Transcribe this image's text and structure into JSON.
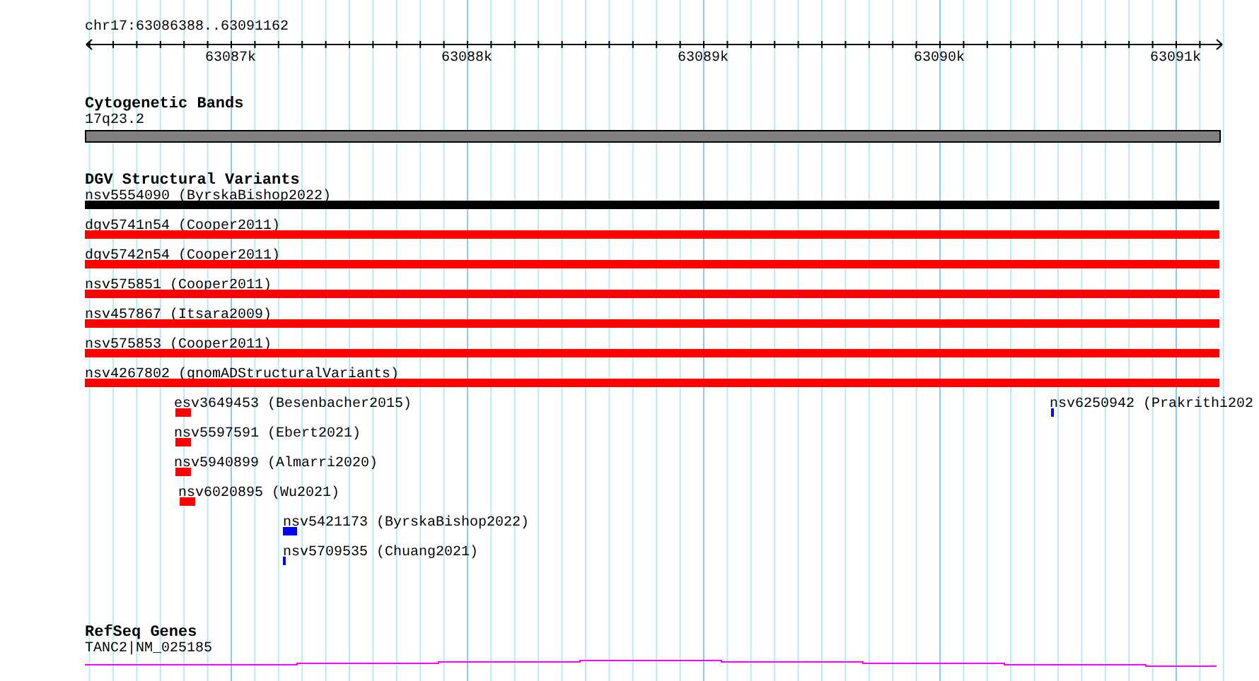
{
  "ruler": {
    "range": "chr17:63086388..63091162",
    "ticks": [
      "63087k",
      "63088k",
      "63089k",
      "63090k",
      "63091k"
    ]
  },
  "tracks": [
    {
      "kind": "cytoband",
      "title": "Cytogenetic Bands",
      "features": [
        {
          "label": "17q23.2",
          "color": "#808080"
        }
      ]
    },
    {
      "kind": "variants",
      "title": "DGV Structural Variants",
      "features": [
        {
          "label": "nsv5554090 (ByrskaBishop2022)",
          "color": "#000000"
        },
        {
          "label": "dgv5741n54 (Cooper2011)",
          "color": "#ff0000"
        },
        {
          "label": "dgv5742n54 (Cooper2011)",
          "color": "#ff0000"
        },
        {
          "label": "nsv575851 (Cooper2011)",
          "color": "#ff0000"
        },
        {
          "label": "nsv457867 (Itsara2009)",
          "color": "#ff0000"
        },
        {
          "label": "nsv575853 (Cooper2011)",
          "color": "#ff0000"
        },
        {
          "label": "nsv4267802 (gnomADStructuralVariants)",
          "color": "#ff0000"
        },
        {
          "label": "esv3649453 (Besenbacher2015)",
          "color": "#ff0000"
        },
        {
          "label": "nsv6250942 (Prakrithi202",
          "color": "#0000ff"
        },
        {
          "label": "nsv5597591 (Ebert2021)",
          "color": "#ff0000"
        },
        {
          "label": "nsv5940899 (Almarri2020)",
          "color": "#ff0000"
        },
        {
          "label": "nsv6020895 (Wu2021)",
          "color": "#ff0000"
        },
        {
          "label": "nsv5421173 (ByrskaBishop2022)",
          "color": "#0000ff"
        },
        {
          "label": "nsv5709535 (Chuang2021)",
          "color": "#0000ff"
        }
      ]
    },
    {
      "kind": "gene",
      "title": "RefSeq Genes",
      "features": [
        {
          "label": "TANC2|NM_025185",
          "color": "#ff00ff"
        }
      ]
    }
  ]
}
